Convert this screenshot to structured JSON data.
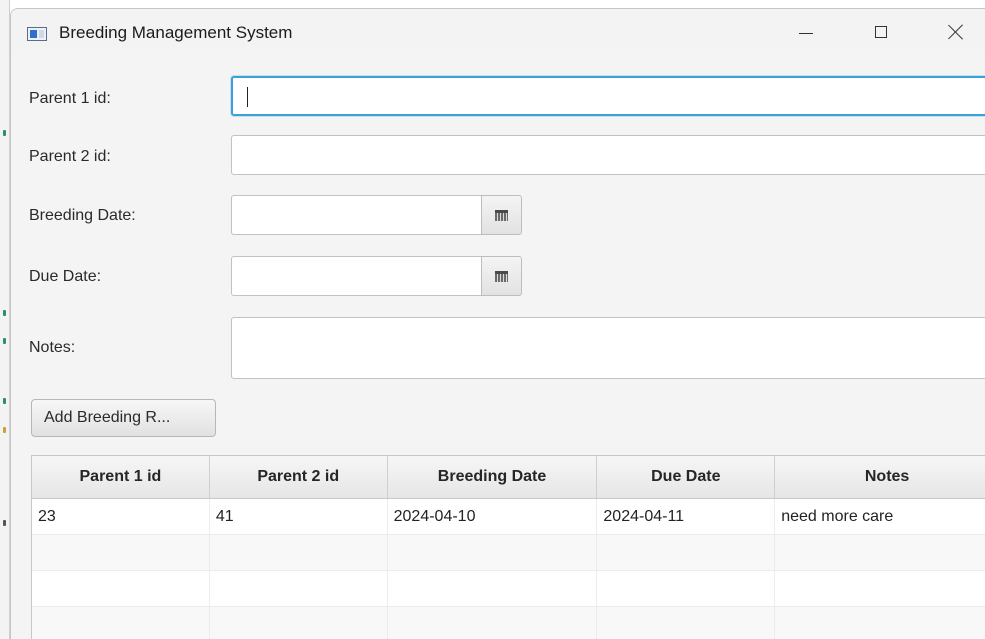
{
  "window": {
    "title": "Breeding Management System"
  },
  "form": {
    "parent1_label": "Parent 1 id:",
    "parent1_value": "",
    "parent2_label": "Parent 2 id:",
    "parent2_value": "",
    "breeding_date_label": "Breeding Date:",
    "breeding_date_value": "",
    "due_date_label": "Due Date:",
    "due_date_value": "",
    "notes_label": "Notes:",
    "notes_value": "",
    "add_button_label": "Add Breeding R..."
  },
  "table": {
    "columns": [
      "Parent 1 id",
      "Parent 2 id",
      "Breeding Date",
      "Due Date",
      "Notes"
    ],
    "rows": [
      [
        "23",
        "41",
        "2024-04-10",
        "2024-04-11",
        "need more care"
      ],
      [
        "",
        "",
        "",
        "",
        ""
      ],
      [
        "",
        "",
        "",
        "",
        ""
      ],
      [
        "",
        "",
        "",
        "",
        ""
      ]
    ]
  },
  "icons": {
    "app": "app-window-icon",
    "minimize": "minimize-icon",
    "maximize": "maximize-icon",
    "close": "close-icon",
    "calendar": "calendar-icon"
  },
  "colors": {
    "focus_border": "#3f9fd6",
    "window_bg": "#f4f4f4"
  }
}
